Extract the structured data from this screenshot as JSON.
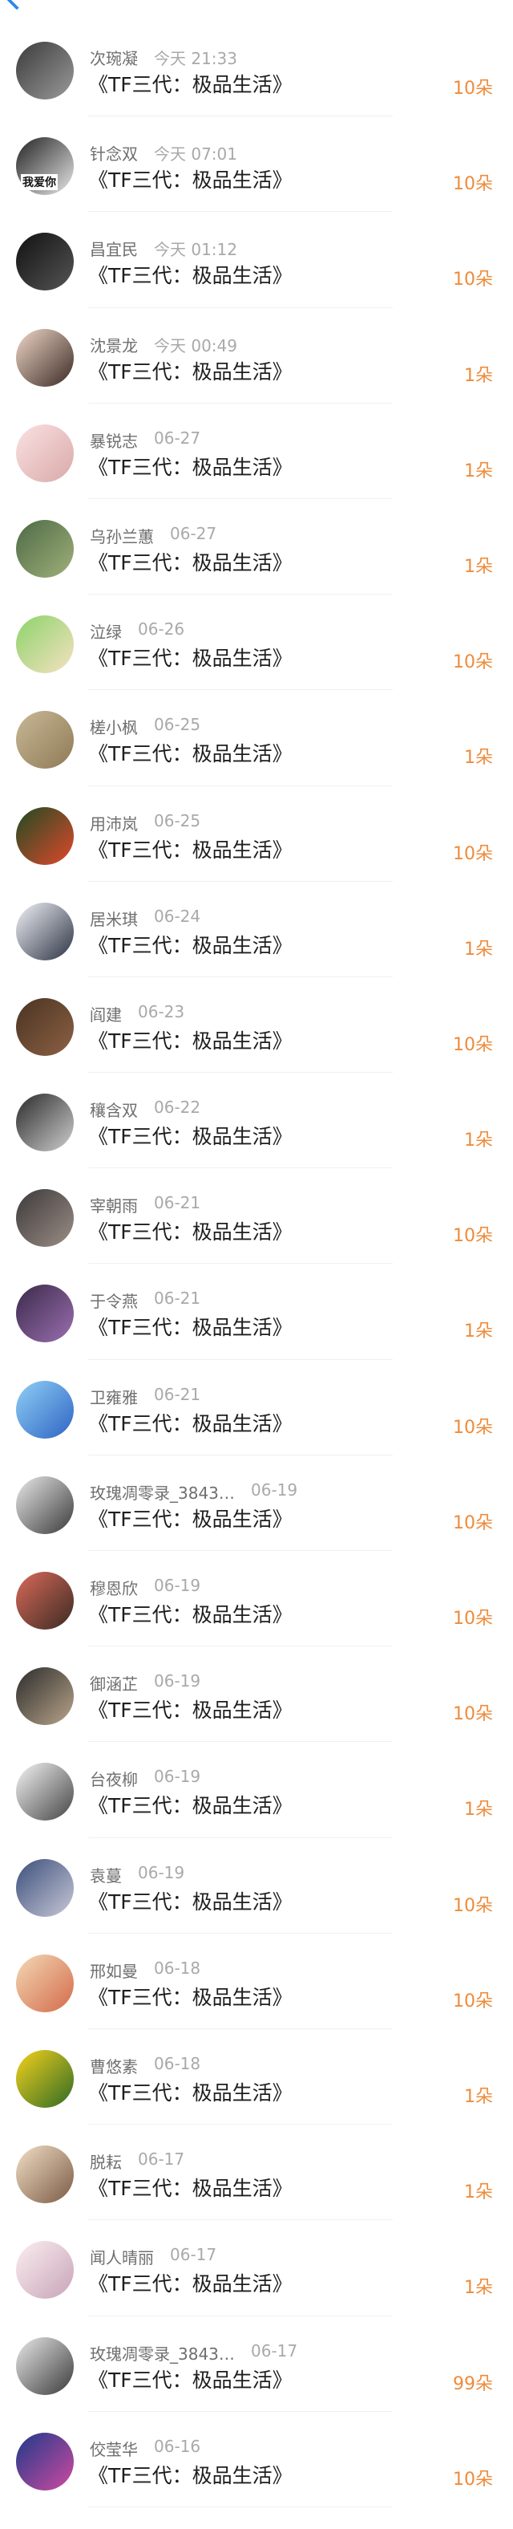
{
  "rows": [
    {
      "name": "次琬凝",
      "time": "今天 21:33",
      "book": "《TF三代：极品生活》",
      "amount": "10朵",
      "colors": [
        "#3b3b3b",
        "#9a9a9a"
      ]
    },
    {
      "name": "针念双",
      "time": "今天 07:01",
      "book": "《TF三代：极品生活》",
      "amount": "10朵",
      "colors": [
        "#222222",
        "#e8e8e8"
      ],
      "avatar_text": "我爱你"
    },
    {
      "name": "昌宜民",
      "time": "今天 01:12",
      "book": "《TF三代：极品生活》",
      "amount": "10朵",
      "colors": [
        "#111111",
        "#555555"
      ]
    },
    {
      "name": "沈景龙",
      "time": "今天 00:49",
      "book": "《TF三代：极品生活》",
      "amount": "1朵",
      "colors": [
        "#f0d7c8",
        "#3a2a24"
      ]
    },
    {
      "name": "暴锐志",
      "time": "06-27",
      "book": "《TF三代：极品生活》",
      "amount": "1朵",
      "colors": [
        "#fbe1e3",
        "#d9a9a8"
      ]
    },
    {
      "name": "乌孙兰蕙",
      "time": "06-27",
      "book": "《TF三代：极品生活》",
      "amount": "1朵",
      "colors": [
        "#4d6a46",
        "#a0b07a"
      ]
    },
    {
      "name": "泣绿",
      "time": "06-26",
      "book": "《TF三代：极品生活》",
      "amount": "10朵",
      "colors": [
        "#8cd36a",
        "#f6e1c1"
      ]
    },
    {
      "name": "槎小枫",
      "time": "06-25",
      "book": "《TF三代：极品生活》",
      "amount": "1朵",
      "colors": [
        "#c8b897",
        "#8f7a55"
      ]
    },
    {
      "name": "用沛岚",
      "time": "06-25",
      "book": "《TF三代：极品生活》",
      "amount": "10朵",
      "colors": [
        "#1e4a22",
        "#e1492b"
      ]
    },
    {
      "name": "居米琪",
      "time": "06-24",
      "book": "《TF三代：极品生活》",
      "amount": "1朵",
      "colors": [
        "#f1f3f8",
        "#2c3242"
      ]
    },
    {
      "name": "阎建",
      "time": "06-23",
      "book": "《TF三代：极品生活》",
      "amount": "10朵",
      "colors": [
        "#4a3322",
        "#8c6144"
      ]
    },
    {
      "name": "穰含双",
      "time": "06-22",
      "book": "《TF三代：极品生活》",
      "amount": "1朵",
      "colors": [
        "#2a2a2a",
        "#cfcfcf"
      ]
    },
    {
      "name": "宰朝雨",
      "time": "06-21",
      "book": "《TF三代：极品生活》",
      "amount": "10朵",
      "colors": [
        "#3c3a3a",
        "#9b8d86"
      ]
    },
    {
      "name": "于令燕",
      "time": "06-21",
      "book": "《TF三代：极品生活》",
      "amount": "1朵",
      "colors": [
        "#3b2a4a",
        "#9a6fb0"
      ]
    },
    {
      "name": "卫雍雅",
      "time": "06-21",
      "book": "《TF三代：极品生活》",
      "amount": "10朵",
      "colors": [
        "#8fd0f5",
        "#2f63c4"
      ]
    },
    {
      "name": "玫瑰凋零录_3843…",
      "time": "06-19",
      "book": "《TF三代：极品生活》",
      "amount": "10朵",
      "colors": [
        "#e9e9e9",
        "#3a3a3a"
      ]
    },
    {
      "name": "穆恩欣",
      "time": "06-19",
      "book": "《TF三代：极品生活》",
      "amount": "10朵",
      "colors": [
        "#d96a5a",
        "#3b2a22"
      ]
    },
    {
      "name": "御涵芷",
      "time": "06-19",
      "book": "《TF三代：极品生活》",
      "amount": "10朵",
      "colors": [
        "#2b2b2b",
        "#b9a58a"
      ]
    },
    {
      "name": "台夜柳",
      "time": "06-19",
      "book": "《TF三代：极品生活》",
      "amount": "1朵",
      "colors": [
        "#f5f5f5",
        "#444444"
      ]
    },
    {
      "name": "袁蔓",
      "time": "06-19",
      "book": "《TF三代：极品生活》",
      "amount": "10朵",
      "colors": [
        "#3b4f7a",
        "#c8c8d8"
      ]
    },
    {
      "name": "邢如曼",
      "time": "06-18",
      "book": "《TF三代：极品生活》",
      "amount": "10朵",
      "colors": [
        "#f3d9b5",
        "#d46a4a"
      ]
    },
    {
      "name": "曹悠素",
      "time": "06-18",
      "book": "《TF三代：极品生活》",
      "amount": "1朵",
      "colors": [
        "#f5d21c",
        "#2e6a25"
      ]
    },
    {
      "name": "脱耘",
      "time": "06-17",
      "book": "《TF三代：极品生活》",
      "amount": "1朵",
      "colors": [
        "#f2dfc6",
        "#7b5a44"
      ]
    },
    {
      "name": "闻人晴丽",
      "time": "06-17",
      "book": "《TF三代：极品生活》",
      "amount": "1朵",
      "colors": [
        "#fbeef0",
        "#c7a4b8"
      ]
    },
    {
      "name": "玫瑰凋零录_3843…",
      "time": "06-17",
      "book": "《TF三代：极品生活》",
      "amount": "99朵",
      "colors": [
        "#e9e9e9",
        "#3a3a3a"
      ]
    },
    {
      "name": "佼莹华",
      "time": "06-16",
      "book": "《TF三代：极品生活》",
      "amount": "10朵",
      "colors": [
        "#1e3a8a",
        "#cf4aa0"
      ]
    }
  ]
}
